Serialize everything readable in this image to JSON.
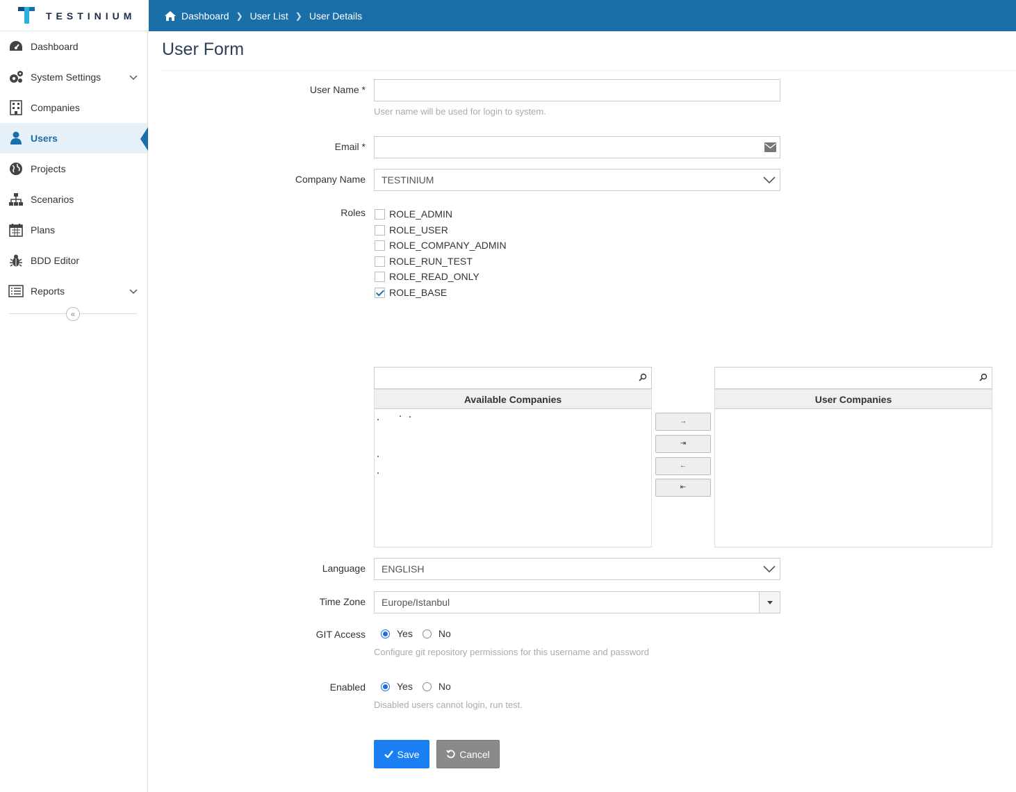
{
  "app": {
    "logo_text": "TESTINIUM"
  },
  "breadcrumb": [
    {
      "label": "Dashboard"
    },
    {
      "label": "User List"
    },
    {
      "label": "User Details"
    }
  ],
  "sidebar": {
    "items": [
      {
        "label": "Dashboard",
        "icon": "dashboard-icon"
      },
      {
        "label": "System Settings",
        "icon": "gears-icon"
      },
      {
        "label": "Companies",
        "icon": "building-icon"
      },
      {
        "label": "Users",
        "icon": "user-icon"
      },
      {
        "label": "Projects",
        "icon": "globe-icon"
      },
      {
        "label": "Scenarios",
        "icon": "sitemap-icon"
      },
      {
        "label": "Plans",
        "icon": "calendar-icon"
      },
      {
        "label": "BDD Editor",
        "icon": "bug-icon"
      },
      {
        "label": "Reports",
        "icon": "list-icon"
      }
    ],
    "active": "Users",
    "collapse_symbol": "«"
  },
  "form": {
    "title": "User Form",
    "username": {
      "label": "User Name *",
      "value": "",
      "help": "User name will be used for login to system."
    },
    "email": {
      "label": "Email *",
      "value": ""
    },
    "company": {
      "label": "Company Name",
      "value": "TESTINIUM"
    },
    "roles": {
      "label": "Roles",
      "items": [
        {
          "name": "ROLE_ADMIN",
          "checked": false
        },
        {
          "name": "ROLE_USER",
          "checked": false
        },
        {
          "name": "ROLE_COMPANY_ADMIN",
          "checked": false
        },
        {
          "name": "ROLE_RUN_TEST",
          "checked": false
        },
        {
          "name": "ROLE_READ_ONLY",
          "checked": false
        },
        {
          "name": "ROLE_BASE",
          "checked": true
        }
      ]
    },
    "companies": {
      "available_header": "Available Companies",
      "user_header": "User Companies",
      "buttons": [
        "→",
        "⇥",
        "←",
        "⇤"
      ]
    },
    "language": {
      "label": "Language",
      "value": "ENGLISH"
    },
    "timezone": {
      "label": "Time Zone",
      "value": "Europe/Istanbul"
    },
    "git_access": {
      "label": "GIT Access",
      "yes": "Yes",
      "no": "No",
      "selected": "Yes",
      "help": "Configure git repository permissions for this username and password"
    },
    "enabled": {
      "label": "Enabled",
      "yes": "Yes",
      "no": "No",
      "selected": "Yes",
      "help": "Disabled users cannot login, run test."
    },
    "save_label": "Save",
    "cancel_label": "Cancel"
  },
  "colors": {
    "brand": "#1a6fa8",
    "save": "#1a7ff0",
    "cancel": "#8a8a8a"
  }
}
